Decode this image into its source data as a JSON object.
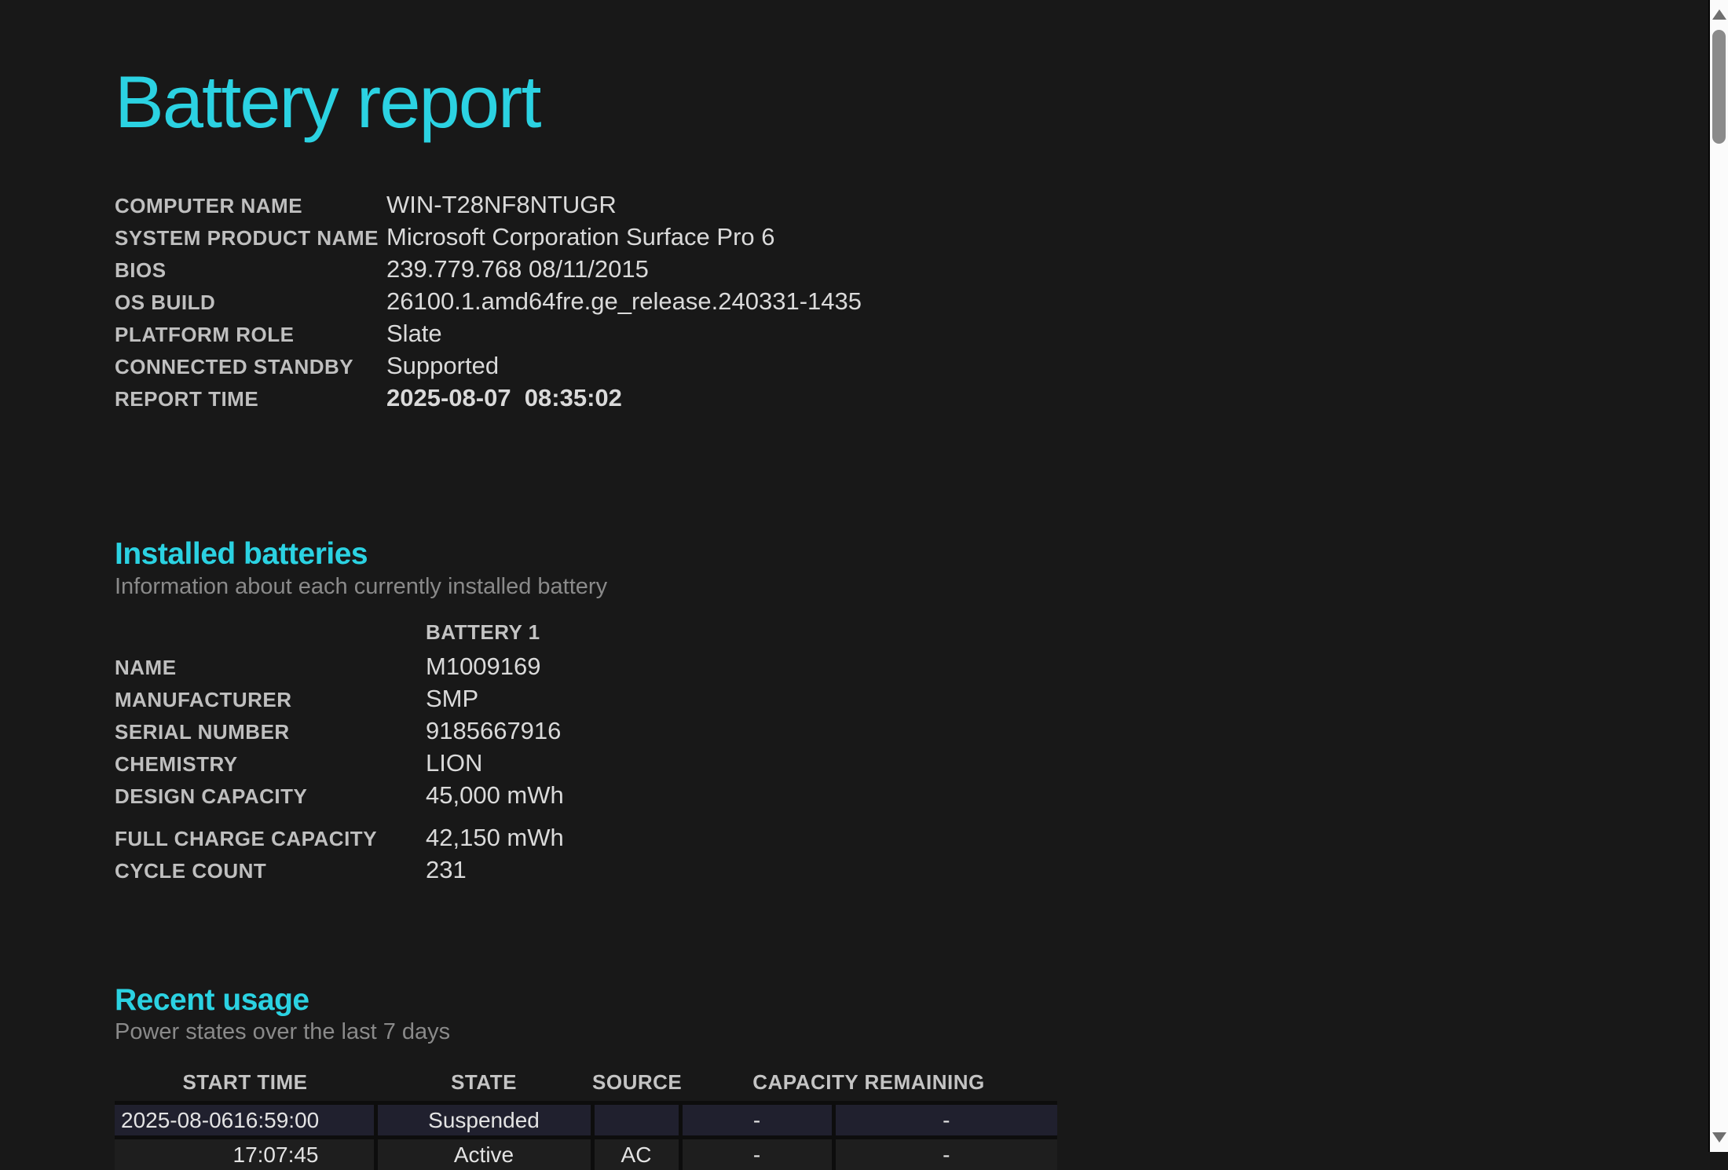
{
  "page": {
    "title": "Battery report"
  },
  "colors": {
    "background": "#181818",
    "accent_cyan": "#2bd2e2",
    "label_gray": "#bfbfbf",
    "value_gray": "#dadada",
    "subtitle_gray": "#8a8a8a",
    "table_row_bg": "#1e1e1e",
    "table_row_alt_bg": "#20202e",
    "table_border": "#0d0d0d",
    "scrollbar_track": "#fbfbfb",
    "scrollbar_thumb": "#8b8b8b"
  },
  "system_info": {
    "rows": [
      {
        "label": "COMPUTER NAME",
        "value": "WIN-T28NF8NTUGR",
        "value_bold": false
      },
      {
        "label": "SYSTEM PRODUCT NAME",
        "value": "Microsoft Corporation Surface Pro 6",
        "value_bold": false
      },
      {
        "label": "BIOS",
        "value": "239.779.768 08/11/2015",
        "value_bold": false
      },
      {
        "label": "OS BUILD",
        "value": "26100.1.amd64fre.ge_release.240331-1435",
        "value_bold": false
      },
      {
        "label": "PLATFORM ROLE",
        "value": "Slate",
        "value_bold": false
      },
      {
        "label": "CONNECTED STANDBY",
        "value": "Supported",
        "value_bold": false
      },
      {
        "label": "REPORT TIME",
        "value": "2025-08-07  08:35:02",
        "value_bold": true
      }
    ]
  },
  "installed_batteries": {
    "heading": "Installed batteries",
    "subtitle": "Information about each currently installed battery",
    "column_header": "BATTERY 1",
    "rows": [
      {
        "label": "NAME",
        "value": "M1009169",
        "gap_above": false
      },
      {
        "label": "MANUFACTURER",
        "value": "SMP",
        "gap_above": false
      },
      {
        "label": "SERIAL NUMBER",
        "value": "9185667916",
        "gap_above": false
      },
      {
        "label": "CHEMISTRY",
        "value": "LION",
        "gap_above": false
      },
      {
        "label": "DESIGN CAPACITY",
        "value": "45,000 mWh",
        "gap_above": false
      },
      {
        "label": "FULL CHARGE CAPACITY",
        "value": "42,150 mWh",
        "gap_above": true
      },
      {
        "label": "CYCLE COUNT",
        "value": "231",
        "gap_above": false
      }
    ]
  },
  "recent_usage": {
    "heading": "Recent usage",
    "subtitle": "Power states over the last 7 days",
    "table": {
      "headers": {
        "start_time": "START TIME",
        "state": "STATE",
        "source": "SOURCE",
        "capacity_remaining": "CAPACITY REMAINING"
      },
      "rows": [
        {
          "date": "2025-08-06",
          "time": "16:59:00",
          "state": "Suspended",
          "source": "",
          "capacity_percent": "-",
          "capacity_mwh": "-",
          "highlighted": true
        },
        {
          "date": "",
          "time": "17:07:45",
          "state": "Active",
          "source": "AC",
          "capacity_percent": "-",
          "capacity_mwh": "-",
          "highlighted": false
        }
      ]
    }
  },
  "scrollbar": {
    "up_arrow_icon": "scroll-up-arrow",
    "down_arrow_icon": "scroll-down-arrow"
  }
}
